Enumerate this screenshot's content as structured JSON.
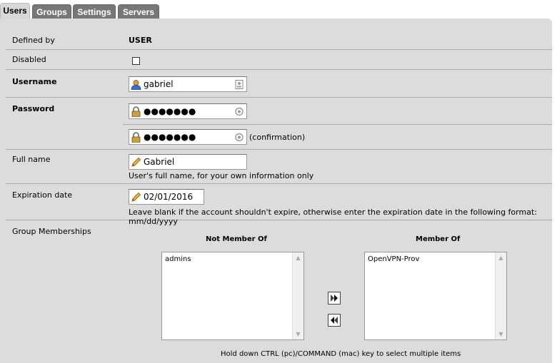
{
  "tabs": [
    "Users",
    "Groups",
    "Settings",
    "Servers"
  ],
  "form": {
    "defined_by": {
      "label": "Defined by",
      "value": "USER"
    },
    "disabled": {
      "label": "Disabled",
      "checked": false
    },
    "username": {
      "label": "Username",
      "value": "gabriel"
    },
    "password": {
      "label": "Password",
      "value": "●●●●●●●",
      "confirm_value": "●●●●●●●",
      "confirm_suffix": "(confirmation)"
    },
    "fullname": {
      "label": "Full name",
      "value": "Gabriel",
      "help": "User's full name, for your own information only"
    },
    "expiration": {
      "label": "Expiration date",
      "value": "02/01/2016",
      "help": "Leave blank if the account shouldn't expire, otherwise enter the expiration date in the following format: mm/dd/yyyy"
    },
    "groups": {
      "label": "Group Memberships",
      "not_member_header": "Not Member Of",
      "member_header": "Member Of",
      "not_member_items": [
        "admins"
      ],
      "member_items": [
        "OpenVPN-Prov"
      ],
      "hint": "Hold down CTRL (pc)/COMMAND (mac) key to select multiple items"
    }
  },
  "colors": {
    "tab_bg": "#777777",
    "tab_active_bg": "#d8d8d8",
    "panel_bg": "#dcdcdc"
  }
}
